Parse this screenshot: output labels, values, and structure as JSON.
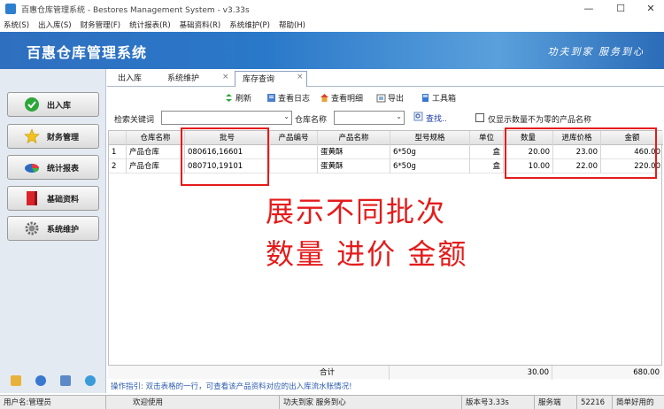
{
  "window": {
    "title": "百惠仓库管理系统 - Bestores Management System - v3.33s",
    "minimize": "—",
    "maximize": "☐",
    "close": "✕"
  },
  "menu": [
    "系统(S)",
    "出入库(S)",
    "财务管理(F)",
    "统计报表(R)",
    "基础资料(R)",
    "系统维护(P)",
    "帮助(H)"
  ],
  "banner": {
    "title": "百惠仓库管理系统",
    "slogan": "功夫到家 服务到心"
  },
  "sidebar": {
    "items": [
      {
        "label": "出入库",
        "icon": "check-circle-icon"
      },
      {
        "label": "财务管理",
        "icon": "star-icon"
      },
      {
        "label": "统计报表",
        "icon": "pie-chart-icon"
      },
      {
        "label": "基础资料",
        "icon": "book-icon"
      },
      {
        "label": "系统维护",
        "icon": "gear-icon"
      }
    ]
  },
  "tabs": [
    {
      "label": "出入库",
      "active": false
    },
    {
      "label": "系统维护",
      "active": false
    },
    {
      "label": "库存查询",
      "active": true
    }
  ],
  "tab_close": "×",
  "toolbar": {
    "refresh": "刷新",
    "view_log": "查看日志",
    "view_detail": "查看明细",
    "export": "导出",
    "toolbox": "工具箱"
  },
  "filter": {
    "keyword_label": "检索关键词",
    "keyword_value": "",
    "warehouse_label": "仓库名称",
    "warehouse_value": "",
    "search_label": "查找..",
    "nonzero_label": "仅显示数量不为零的产品名称",
    "arrow": "⌄"
  },
  "grid": {
    "columns": [
      "",
      "仓库名称",
      "批号",
      "产品编号",
      "产品名称",
      "型号规格",
      "单位",
      "数量",
      "进库价格",
      "金额"
    ],
    "rows": [
      [
        "1",
        "产品仓库",
        "080616,16601",
        "",
        "蛋黄酥",
        "6*50g",
        "盒",
        "20.00",
        "23.00",
        "460.00"
      ],
      [
        "2",
        "产品仓库",
        "080710,19101",
        "",
        "蛋黄酥",
        "6*50g",
        "盒",
        "10.00",
        "22.00",
        "220.00"
      ]
    ],
    "total": {
      "label": "合计",
      "quantity": "30.00",
      "amount": "680.00"
    }
  },
  "annotation": {
    "line1": "展示不同批次",
    "line2": "数量 进价 金额",
    "color": "#e41b1b"
  },
  "guide": "操作指引: 双击表格的一行，可查看该产品资料对应的出入库流水账情况!",
  "status": {
    "user": "用户名:管理员",
    "welcome": "欢迎使用",
    "slogan": "功夫到家 服务到心",
    "version": "版本号3.33s",
    "server": "服务端",
    "port": "52216",
    "tail": "简单好用的"
  }
}
